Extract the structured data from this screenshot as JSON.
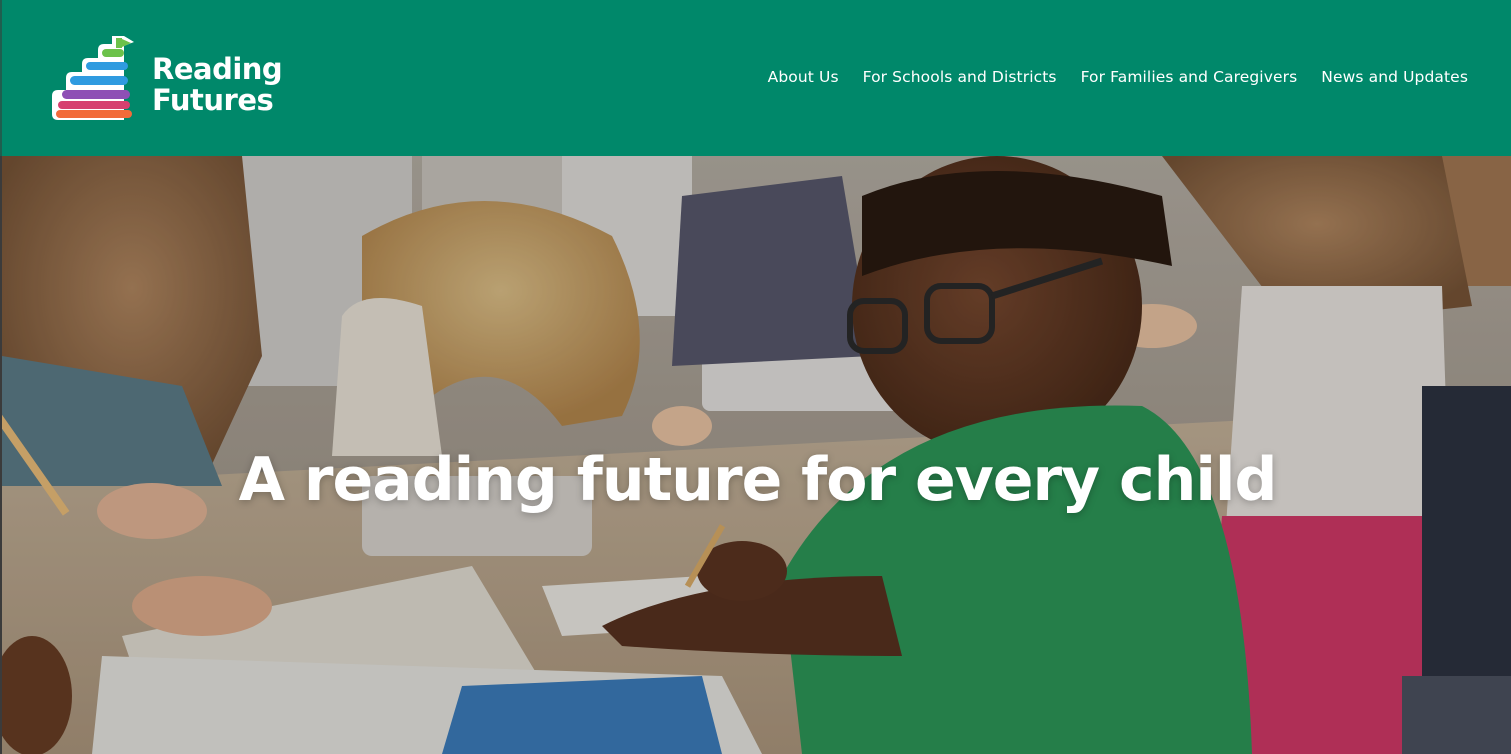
{
  "header": {
    "background_color": "#00886a",
    "logo": {
      "line1": "Reading",
      "line2": "Futures",
      "icon": "stacked-books-flag-logo-icon"
    },
    "nav": [
      {
        "label": "About Us"
      },
      {
        "label": "For Schools and Districts"
      },
      {
        "label": "For Families and Caregivers"
      },
      {
        "label": "News and Updates"
      }
    ]
  },
  "hero": {
    "title": "A reading future for every child",
    "image": "classroom-children-writing-photo"
  },
  "colors": {
    "brand_green": "#00886a",
    "book_orange": "#f26b3a",
    "book_pink": "#d6406f",
    "book_purple": "#8e4fb5",
    "book_blue": "#2f9be0",
    "flag_green": "#6cc24a"
  }
}
